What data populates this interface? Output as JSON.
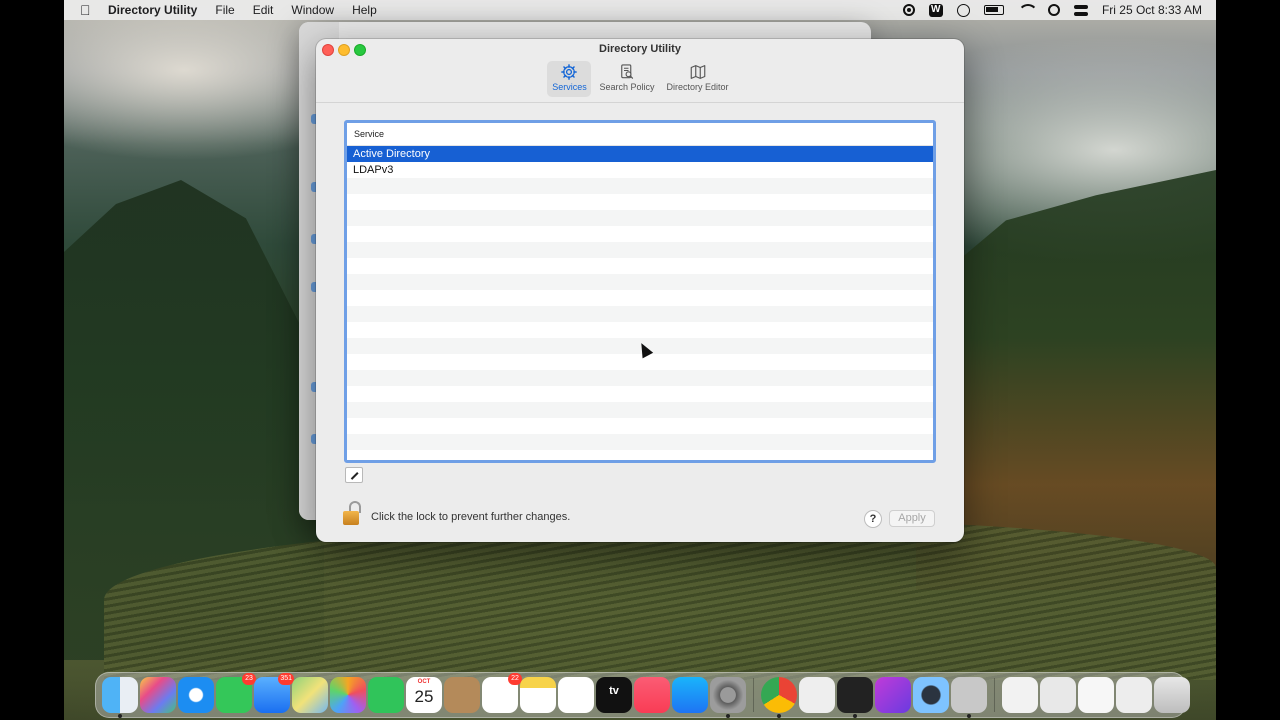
{
  "menubar": {
    "app_name": "Directory Utility",
    "menus": [
      "File",
      "Edit",
      "Window",
      "Help"
    ],
    "clock": "Fri 25 Oct  8:33 AM"
  },
  "window": {
    "title": "Directory Utility",
    "tabs": [
      {
        "label": "Services",
        "icon": "gear-icon",
        "active": true
      },
      {
        "label": "Search Policy",
        "icon": "search-doc-icon",
        "active": false
      },
      {
        "label": "Directory Editor",
        "icon": "map-icon",
        "active": false
      }
    ],
    "table": {
      "header": "Service",
      "rows": [
        "Active Directory",
        "LDAPv3"
      ],
      "selected_index": 0
    },
    "lock_text": "Click the lock to prevent further changes.",
    "help_label": "?",
    "apply_label": "Apply"
  },
  "dock": {
    "badges": {
      "messages": "23",
      "mail": "351",
      "reminders": "22"
    },
    "calendar": {
      "month": "OCT",
      "day": "25"
    },
    "tv_label": "tv"
  },
  "colors": {
    "accent": "#1760d3",
    "focus_ring": "#6f9fe6",
    "close": "#ff5f57",
    "minimize": "#febc2e",
    "maximize": "#28c840"
  }
}
